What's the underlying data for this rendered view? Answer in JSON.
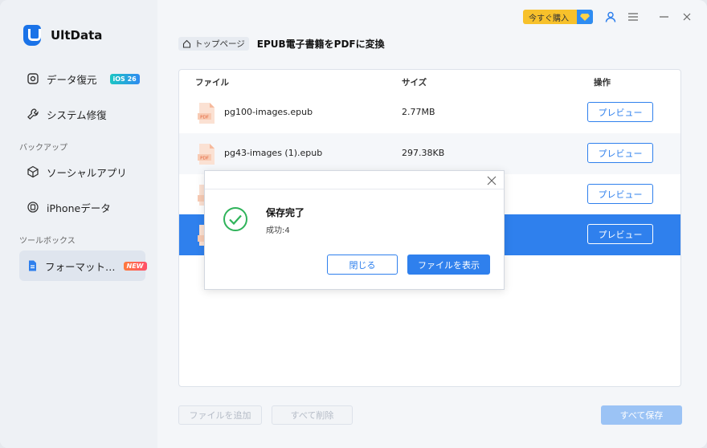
{
  "app": {
    "name": "UltData"
  },
  "sidebar": {
    "items": [
      {
        "label": "データ復元",
        "badge": "iOS 26"
      },
      {
        "label": "システム修復"
      },
      {
        "label": "ソーシャルアプリ"
      },
      {
        "label": "iPhoneデータ"
      },
      {
        "label": "フォーマット…",
        "badge": "NEW"
      }
    ],
    "sections": [
      "バックアップ",
      "ツールボックス"
    ]
  },
  "topbar": {
    "buy_label": "今すぐ購入"
  },
  "breadcrumb": {
    "home": "トップページ",
    "title": "EPUB電子書籍をPDFに変換"
  },
  "table": {
    "headers": {
      "file": "ファイル",
      "size": "サイズ",
      "action": "操作"
    },
    "rows": [
      {
        "name": "pg100-images.epub",
        "size": "2.77MB",
        "action": "プレビュー"
      },
      {
        "name": "pg43-images (1).epub",
        "size": "297.38KB",
        "action": "プレビュー"
      },
      {
        "name": "",
        "size": "",
        "action": "プレビュー"
      },
      {
        "name": "",
        "size": "",
        "action": "プレビュー"
      }
    ],
    "pdf_icon_label": "PDF"
  },
  "footer": {
    "add_label": "ファイルを追加",
    "delete_label": "すべて削除",
    "save_all_label": "すべて保存"
  },
  "dialog": {
    "title": "保存完了",
    "message": "成功:4",
    "close_label": "閉じる",
    "show_label": "ファイルを表示"
  },
  "colors": {
    "accent": "#2f80ed",
    "buy": "#f7c12b",
    "success": "#2fb35a"
  }
}
